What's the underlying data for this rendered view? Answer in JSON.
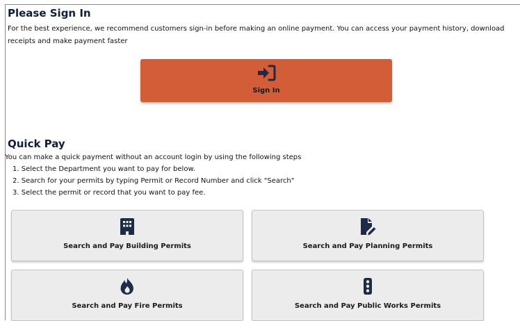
{
  "signin": {
    "title": "Please Sign In",
    "description": "For the best experience, we recommend customers sign-in before making an online payment. You can access your payment history, download receipts and make payment faster",
    "button_label": "Sign In",
    "button_color": "#d35d37",
    "button_icon": "sign-in-icon"
  },
  "quickpay": {
    "title": "Quick Pay",
    "description": "You can make a quick payment without an account login by using the following steps",
    "steps": [
      "1. Select the Department you want to pay for below.",
      "2. Search for your permits by typing Permit or Record Number and click \"Search\"",
      "3. Select the permit or record that you want to pay fee."
    ],
    "buttons": [
      {
        "label": "Search and Pay Building Permits",
        "icon": "building-icon"
      },
      {
        "label": "Search and Pay Planning Permits",
        "icon": "file-signature-icon"
      },
      {
        "label": "Search and Pay Fire Permits",
        "icon": "fire-icon"
      },
      {
        "label": "Search and Pay Public Works Permits",
        "icon": "traffic-light-icon"
      }
    ]
  },
  "colors": {
    "heading": "#0e1f3d",
    "card_background": "#ececec",
    "icon": "#1f2a44"
  }
}
